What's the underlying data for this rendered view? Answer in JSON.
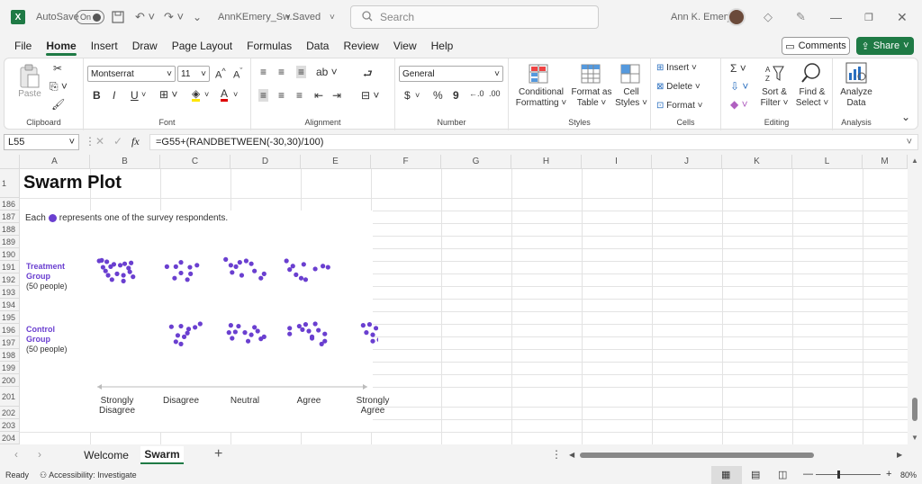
{
  "titlebar": {
    "logo": "X",
    "autosave_label": "AutoSave",
    "autosave_state": "On",
    "filename": "AnnKEmery_Sw...",
    "saved": "• Saved",
    "search_placeholder": "Search",
    "user": "Ann K. Emery"
  },
  "menu": [
    "File",
    "Home",
    "Insert",
    "Draw",
    "Page Layout",
    "Formulas",
    "Data",
    "Review",
    "View",
    "Help"
  ],
  "menu_active": "Home",
  "buttons": {
    "comments": "Comments",
    "share": "Share"
  },
  "ribbon": {
    "clipboard": {
      "label": "Clipboard",
      "paste": "Paste"
    },
    "font": {
      "label": "Font",
      "name": "Montserrat",
      "size": "11",
      "bold": "B",
      "italic": "I",
      "underline": "U"
    },
    "alignment": {
      "label": "Alignment"
    },
    "number": {
      "label": "Number",
      "format": "General",
      "currency": "$",
      "percent": "%",
      "comma": "9"
    },
    "styles": {
      "label": "Styles",
      "conditional_1": "Conditional",
      "conditional_2": "Formatting ˅",
      "format_table_1": "Format as",
      "format_table_2": "Table ˅",
      "cell_styles_1": "Cell",
      "cell_styles_2": "Styles ˅"
    },
    "cells": {
      "label": "Cells",
      "insert": "Insert",
      "delete": "Delete",
      "format": "Format"
    },
    "editing": {
      "label": "Editing",
      "sort_1": "Sort &",
      "sort_2": "Filter ˅",
      "find_1": "Find &",
      "find_2": "Select ˅"
    },
    "analysis": {
      "label": "Analysis",
      "analyze_1": "Analyze",
      "analyze_2": "Data"
    }
  },
  "formula_bar": {
    "cell": "L55",
    "fx": "fx",
    "formula": "=G55+(RANDBETWEEN(-30,30)/100)"
  },
  "columns": [
    "A",
    "B",
    "C",
    "D",
    "E",
    "F",
    "G",
    "H",
    "I",
    "J",
    "K",
    "L",
    "M"
  ],
  "rows": [
    "1",
    "186",
    "187",
    "188",
    "189",
    "190",
    "191",
    "192",
    "193",
    "194",
    "195",
    "196",
    "197",
    "198",
    "199",
    "200",
    "201",
    "202",
    "203",
    "204"
  ],
  "sheet": {
    "title": "Swarm Plot",
    "subtitle_before": "Each",
    "subtitle_after": "represents one of the survey respondents."
  },
  "chart_data": {
    "type": "scatter",
    "title": "Swarm Plot",
    "accent_color": "#6a3fd0",
    "groups": [
      {
        "name_1": "Treatment",
        "name_2": "Group",
        "count": "(50 people)"
      },
      {
        "name_1": "Control",
        "name_2": "Group",
        "count": "(50 people)"
      }
    ],
    "categories": [
      {
        "l1": "Strongly",
        "l2": "Disagree"
      },
      {
        "l1": "Disagree",
        "l2": ""
      },
      {
        "l1": "Neutral",
        "l2": ""
      },
      {
        "l1": "Agree",
        "l2": ""
      },
      {
        "l1": "Strongly",
        "l2": "Agree"
      }
    ],
    "series": [
      {
        "group": "Treatment",
        "points": [
          [
            0.72,
            1.0
          ],
          [
            0.76,
            1.02
          ],
          [
            0.84,
            0.97
          ],
          [
            0.9,
            0.8
          ],
          [
            0.78,
            0.78
          ],
          [
            0.95,
            0.88
          ],
          [
            1.05,
            0.85
          ],
          [
            1.12,
            0.9
          ],
          [
            1.18,
            0.75
          ],
          [
            1.22,
            0.93
          ],
          [
            0.86,
            0.5
          ],
          [
            1.0,
            0.55
          ],
          [
            1.1,
            0.5
          ],
          [
            1.2,
            0.62
          ],
          [
            0.92,
            0.35
          ],
          [
            1.1,
            0.3
          ],
          [
            1.25,
            0.45
          ],
          [
            0.82,
            0.65
          ],
          [
            1.78,
            0.8
          ],
          [
            1.92,
            0.8
          ],
          [
            2.0,
            0.95
          ],
          [
            2.14,
            0.78
          ],
          [
            2.25,
            0.85
          ],
          [
            2.0,
            0.58
          ],
          [
            2.15,
            0.55
          ],
          [
            1.9,
            0.4
          ],
          [
            2.1,
            0.35
          ],
          [
            2.7,
            1.05
          ],
          [
            2.78,
            0.85
          ],
          [
            2.86,
            0.8
          ],
          [
            2.92,
            0.95
          ],
          [
            3.02,
            1.0
          ],
          [
            3.1,
            0.9
          ],
          [
            3.15,
            0.65
          ],
          [
            3.25,
            0.4
          ],
          [
            3.3,
            0.55
          ],
          [
            2.95,
            0.5
          ],
          [
            2.8,
            0.6
          ],
          [
            3.65,
            1.0
          ],
          [
            3.75,
            0.82
          ],
          [
            3.92,
            0.88
          ],
          [
            3.8,
            0.52
          ],
          [
            3.88,
            0.4
          ],
          [
            3.95,
            0.35
          ],
          [
            4.1,
            0.72
          ],
          [
            4.22,
            0.82
          ],
          [
            4.3,
            0.78
          ],
          [
            3.7,
            0.7
          ]
        ]
      },
      {
        "group": "Control",
        "points": [
          [
            1.85,
            0.9
          ],
          [
            2.0,
            0.92
          ],
          [
            2.12,
            0.82
          ],
          [
            2.22,
            0.88
          ],
          [
            2.3,
            1.0
          ],
          [
            1.95,
            0.6
          ],
          [
            2.05,
            0.55
          ],
          [
            2.1,
            0.68
          ],
          [
            1.92,
            0.38
          ],
          [
            2.0,
            0.3
          ],
          [
            2.78,
            0.95
          ],
          [
            2.9,
            0.92
          ],
          [
            2.75,
            0.7
          ],
          [
            2.85,
            0.72
          ],
          [
            3.0,
            0.7
          ],
          [
            3.1,
            0.62
          ],
          [
            3.2,
            0.75
          ],
          [
            3.3,
            0.55
          ],
          [
            2.8,
            0.5
          ],
          [
            3.05,
            0.4
          ],
          [
            3.25,
            0.48
          ],
          [
            3.15,
            0.88
          ],
          [
            3.7,
            0.85
          ],
          [
            3.85,
            0.92
          ],
          [
            3.95,
            0.98
          ],
          [
            4.1,
            1.0
          ],
          [
            3.9,
            0.8
          ],
          [
            4.0,
            0.75
          ],
          [
            4.15,
            0.78
          ],
          [
            3.7,
            0.65
          ],
          [
            4.05,
            0.55
          ],
          [
            4.25,
            0.65
          ],
          [
            4.25,
            0.4
          ],
          [
            4.2,
            0.3
          ],
          [
            4.05,
            0.5
          ],
          [
            4.85,
            0.95
          ],
          [
            4.95,
            0.98
          ],
          [
            5.05,
            0.85
          ],
          [
            5.15,
            0.78
          ],
          [
            5.25,
            0.95
          ],
          [
            5.3,
            0.82
          ],
          [
            4.9,
            0.7
          ],
          [
            5.0,
            0.62
          ],
          [
            5.15,
            0.55
          ],
          [
            5.1,
            0.45
          ],
          [
            5.0,
            0.4
          ],
          [
            5.2,
            0.72
          ],
          [
            5.35,
            0.65
          ]
        ]
      }
    ]
  },
  "sheet_tabs": [
    "Welcome",
    "Swarm"
  ],
  "active_tab": "Swarm",
  "status": {
    "ready": "Ready",
    "accessibility": "Accessibility: Investigate",
    "zoom": "80%"
  }
}
